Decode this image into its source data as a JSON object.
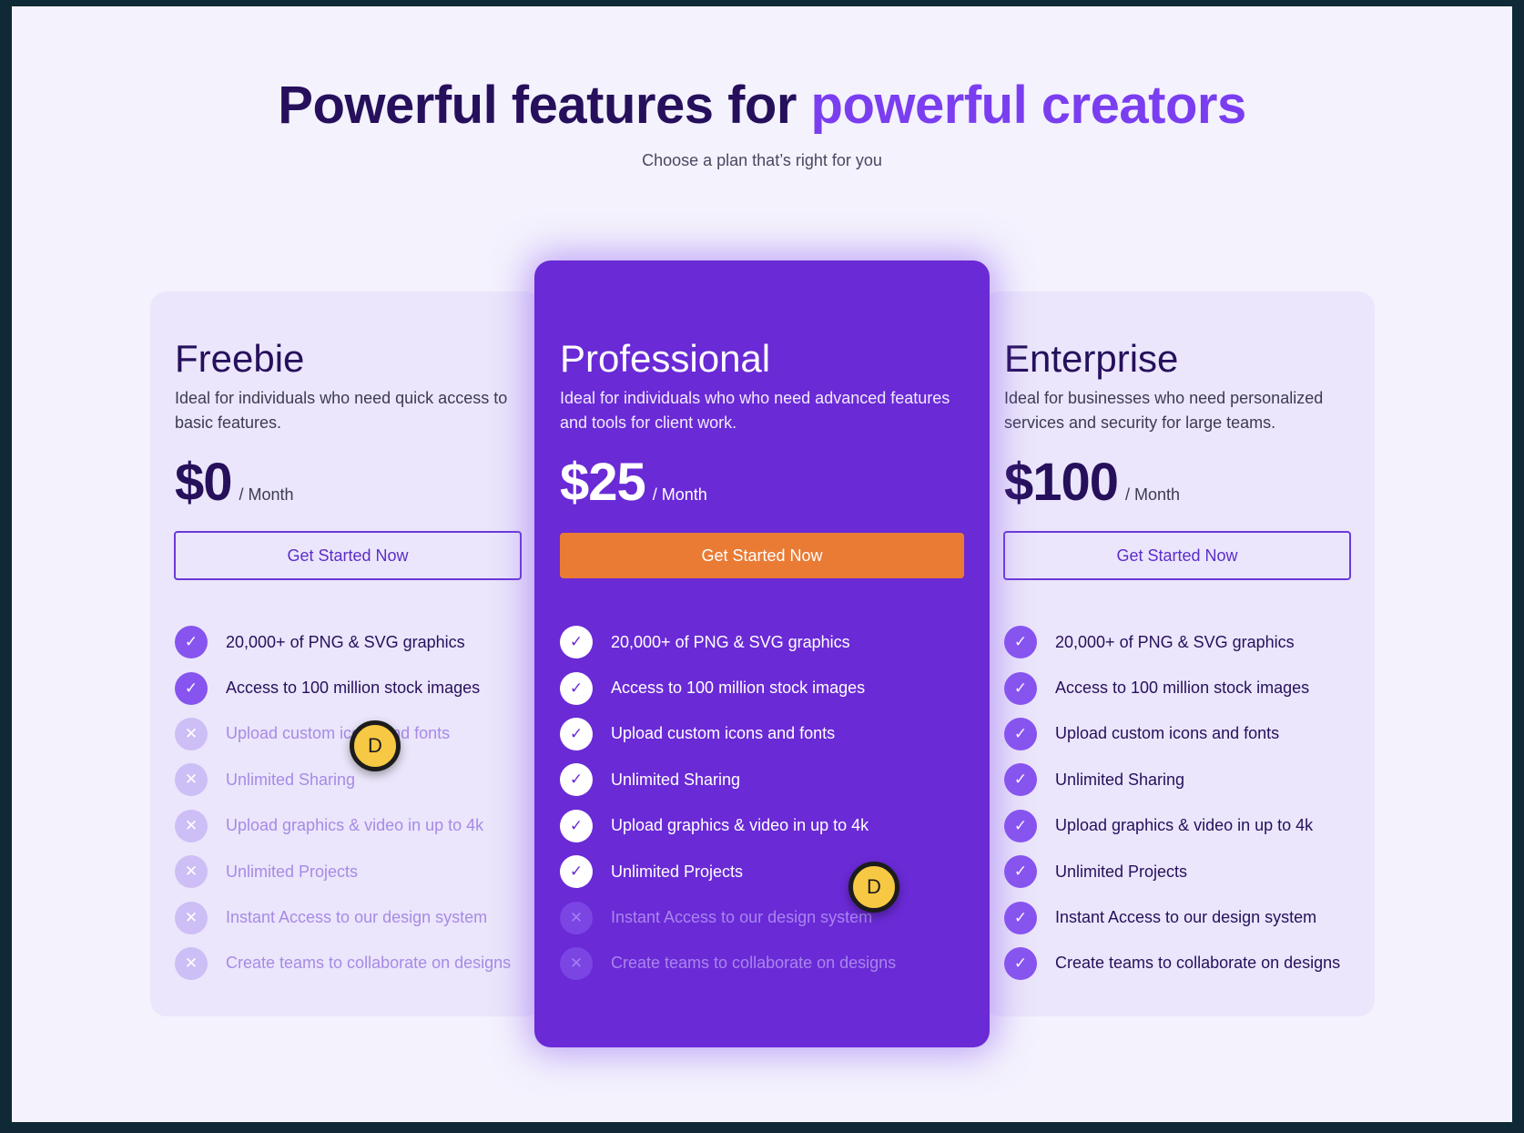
{
  "hero": {
    "title_main": "Powerful features for",
    "title_accent": "powerful creators",
    "subtitle": "Choose a plan that’s right for you"
  },
  "plans": [
    {
      "name": "Freebie",
      "description": "Ideal for individuals who need quick access to basic features.",
      "price": "$0",
      "period": "/ Month",
      "cta": "Get Started Now",
      "features": [
        {
          "label": "20,000+ of PNG & SVG graphics",
          "included": true
        },
        {
          "label": "Access to 100 million stock images",
          "included": true
        },
        {
          "label": "Upload custom icons and fonts",
          "included": false
        },
        {
          "label": "Unlimited Sharing",
          "included": false
        },
        {
          "label": "Upload graphics & video in up to 4k",
          "included": false
        },
        {
          "label": "Unlimited Projects",
          "included": false
        },
        {
          "label": "Instant Access to our design system",
          "included": false
        },
        {
          "label": "Create teams to collaborate on designs",
          "included": false
        }
      ]
    },
    {
      "name": "Professional",
      "description": "Ideal for individuals who who need advanced features and tools for client work.",
      "price": "$25",
      "period": "/ Month",
      "cta": "Get Started Now",
      "features": [
        {
          "label": "20,000+ of PNG & SVG graphics",
          "included": true
        },
        {
          "label": "Access to 100 million stock images",
          "included": true
        },
        {
          "label": "Upload custom icons and fonts",
          "included": true
        },
        {
          "label": "Unlimited Sharing",
          "included": true
        },
        {
          "label": "Upload graphics & video in up to 4k",
          "included": true
        },
        {
          "label": "Unlimited Projects",
          "included": true
        },
        {
          "label": "Instant Access to our design system",
          "included": false
        },
        {
          "label": "Create teams to collaborate on designs",
          "included": false
        }
      ]
    },
    {
      "name": "Enterprise",
      "description": "Ideal for businesses who need personalized services and security for large teams.",
      "price": "$100",
      "period": "/ Month",
      "cta": "Get Started Now",
      "features": [
        {
          "label": "20,000+ of PNG & SVG graphics",
          "included": true
        },
        {
          "label": "Access to 100 million stock images",
          "included": true
        },
        {
          "label": "Upload custom icons and fonts",
          "included": true
        },
        {
          "label": "Unlimited Sharing",
          "included": true
        },
        {
          "label": "Upload graphics & video in up to 4k",
          "included": true
        },
        {
          "label": "Unlimited Projects",
          "included": true
        },
        {
          "label": "Instant Access to our design system",
          "included": true
        },
        {
          "label": "Create teams to collaborate on designs",
          "included": true
        }
      ]
    }
  ],
  "icons": {
    "included": "check-icon",
    "excluded": "x-icon",
    "check_glyph": "✓",
    "x_glyph": "✕"
  },
  "cursors": [
    {
      "label": "D"
    },
    {
      "label": "D"
    }
  ],
  "colors": {
    "brand_dark": "#26105c",
    "brand_accent": "#7a3ef0",
    "pro_card": "#6a2ad6",
    "cta_primary": "#e97b35",
    "cursor": "#f7c843"
  }
}
